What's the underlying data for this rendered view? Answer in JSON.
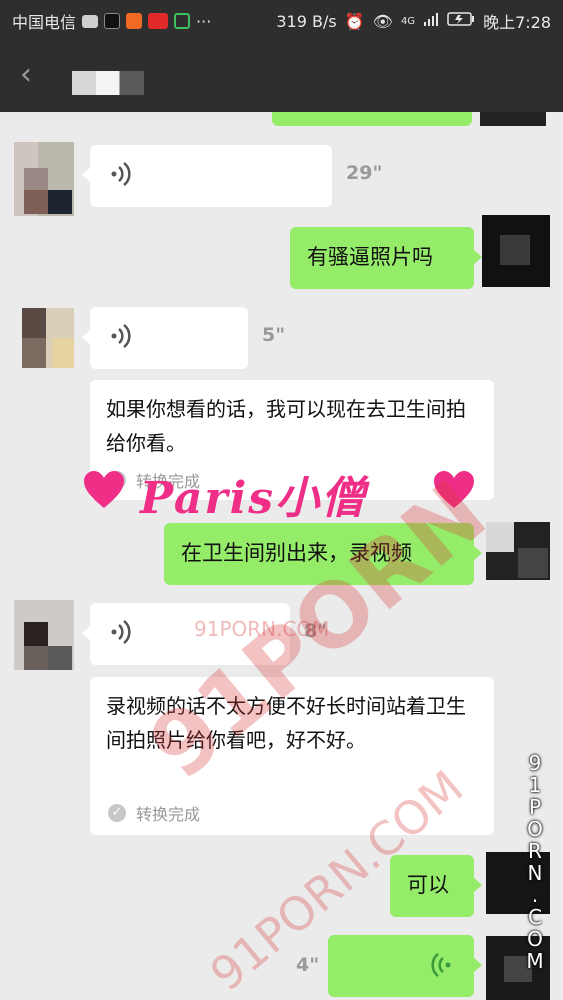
{
  "status_bar": {
    "carrier": "中国电信",
    "network_speed": "319 B/s",
    "signal_label": "4G",
    "time": "晚上7:28",
    "more_label": "···"
  },
  "title_bar": {
    "back_glyph": "‹"
  },
  "messages": [
    {
      "side": "right",
      "type": "voice",
      "note": "partially visible at top"
    },
    {
      "side": "left",
      "type": "voice",
      "duration": "29\""
    },
    {
      "side": "right",
      "type": "text",
      "text": "有骚逼照片吗"
    },
    {
      "side": "left",
      "type": "voice",
      "duration": "5\"",
      "transcript": "如果你想看的话，我可以现在去卫生间拍给你看。",
      "transcript_status": "转换完成"
    },
    {
      "side": "right",
      "type": "text",
      "text": "在卫生间别出来，录视频"
    },
    {
      "side": "left",
      "type": "voice",
      "duration": "8\"",
      "transcript": "录视频的话不太方便不好长时间站着卫生间拍照片给你看吧，好不好。",
      "transcript_status": "转换完成"
    },
    {
      "side": "right",
      "type": "text",
      "text": "可以"
    },
    {
      "side": "right",
      "type": "voice",
      "duration": "4\""
    }
  ],
  "watermarks": {
    "paris": "Paris小僧",
    "site_big": "91PORN",
    "site_mid": "91PORN.COM",
    "site_small": "91PORN.COM",
    "site_vertical": [
      "9",
      "1",
      "P",
      "O",
      "R",
      "N",
      ".",
      "C",
      "O",
      "M"
    ]
  },
  "colors": {
    "background": "#ebebeb",
    "bar": "#2e2e2e",
    "green_bubble": "#95ec69",
    "white_bubble": "#ffffff",
    "watermark_pink": "#ef2f87",
    "watermark_red": "#d63737"
  }
}
